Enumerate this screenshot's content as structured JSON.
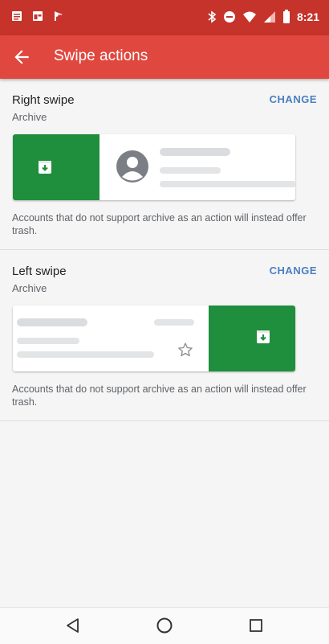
{
  "status_bar": {
    "time": "8:21",
    "left_icons": [
      "message-icon",
      "window-icon",
      "flag-icon"
    ],
    "right_icons": [
      "bluetooth-icon",
      "do-not-disturb-icon",
      "wifi-icon",
      "signal-icon",
      "battery-icon"
    ]
  },
  "app_bar": {
    "title": "Swipe actions",
    "back_icon": "arrow-back-icon"
  },
  "right_swipe": {
    "title": "Right swipe",
    "value": "Archive",
    "change_label": "CHANGE",
    "note": "Accounts that do not support archive as an action will instead offer trash."
  },
  "left_swipe": {
    "title": "Left swipe",
    "value": "Archive",
    "change_label": "CHANGE",
    "note": "Accounts that do not support archive as an action will instead offer trash."
  },
  "colors": {
    "status_bar": "#c5332b",
    "app_bar": "#e0483f",
    "archive_green": "#1f8e3d",
    "accent_link": "#4a7fc1"
  },
  "nav_bar": {
    "icons": [
      "back-triangle-icon",
      "home-circle-icon",
      "recents-square-icon"
    ]
  }
}
